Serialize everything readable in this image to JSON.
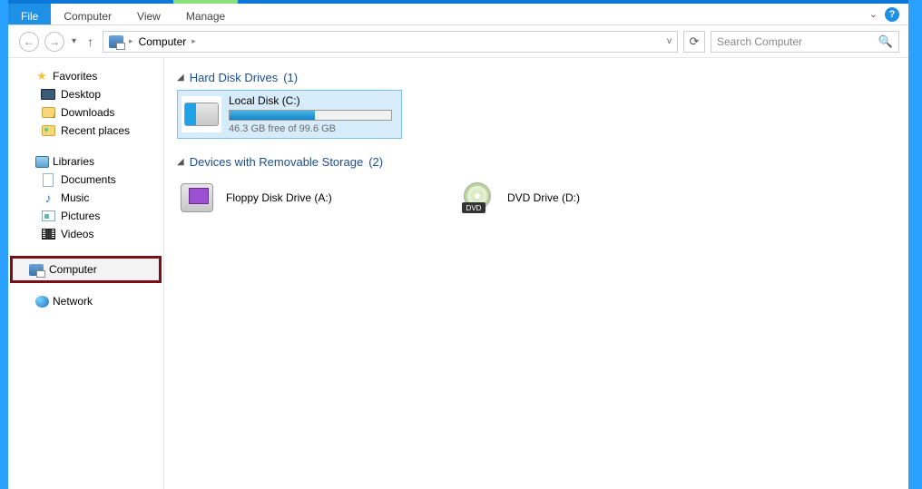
{
  "ribbon": {
    "file": "File",
    "tabs": [
      "Computer",
      "View",
      "Manage"
    ]
  },
  "address": {
    "location": "Computer"
  },
  "search": {
    "placeholder": "Search Computer"
  },
  "sidebar": {
    "favorites": {
      "label": "Favorites",
      "items": [
        "Desktop",
        "Downloads",
        "Recent places"
      ]
    },
    "libraries": {
      "label": "Libraries",
      "items": [
        "Documents",
        "Music",
        "Pictures",
        "Videos"
      ]
    },
    "computer": {
      "label": "Computer"
    },
    "network": {
      "label": "Network"
    }
  },
  "content": {
    "hdd_section": {
      "title": "Hard Disk Drives",
      "count": "(1)",
      "drive": {
        "name": "Local Disk (C:)",
        "free_text": "46.3 GB free of 99.6 GB",
        "fill_percent": 53
      }
    },
    "removable_section": {
      "title": "Devices with Removable Storage",
      "count": "(2)",
      "items": [
        "Floppy Disk Drive (A:)",
        "DVD Drive (D:)"
      ]
    }
  }
}
